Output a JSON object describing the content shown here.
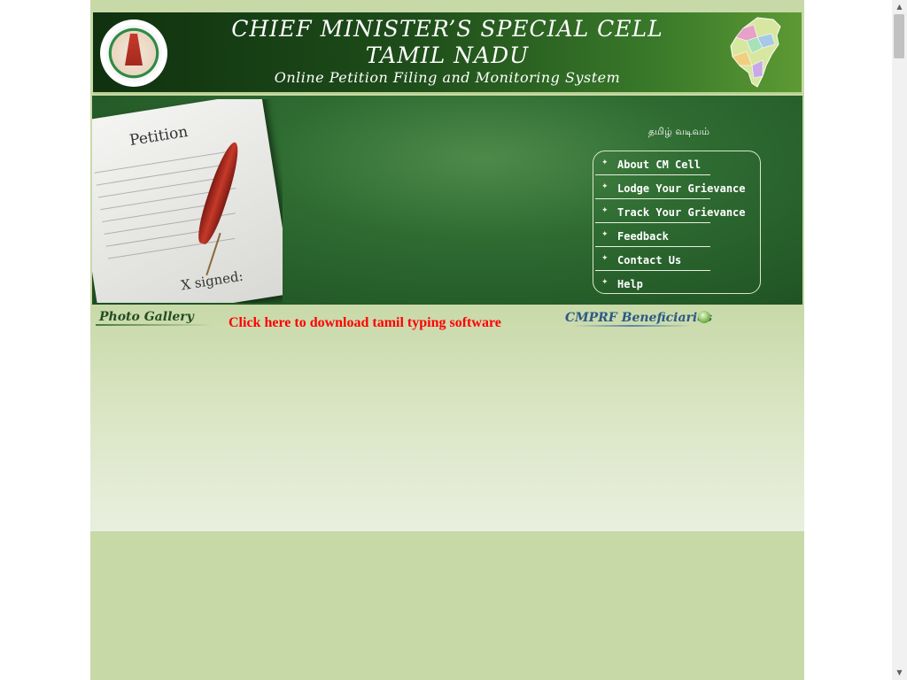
{
  "header": {
    "title_line1": "CHIEF MINISTER’S SPECIAL CELL",
    "title_line2": "TAMIL NADU",
    "subtitle": "Online Petition Filing and Monitoring System"
  },
  "banner": {
    "petition_label": "Petition",
    "signed_label": "X signed:",
    "language_link": "தமிழ் வடிவம்"
  },
  "menu": {
    "items": [
      {
        "label": "About CM Cell"
      },
      {
        "label": "Lodge Your Grievance"
      },
      {
        "label": "Track Your Grievance"
      },
      {
        "label": "Feedback"
      },
      {
        "label": "Contact Us"
      },
      {
        "label": "Help"
      }
    ]
  },
  "links": {
    "photo_gallery": "Photo Gallery",
    "download_tamil": "Click here to download tamil typing software",
    "cmprf": "CMPRF Beneficiaries"
  },
  "colors": {
    "page_bg": "#c8d9a8",
    "header_dark": "#10310f",
    "download_red": "#ff0000",
    "cmprf_blue": "#2b5a85"
  },
  "icons": {
    "emblem": "tamil-nadu-emblem",
    "map": "tamil-nadu-map",
    "quill": "quill-pen",
    "cmprf": "leaf-icon"
  }
}
